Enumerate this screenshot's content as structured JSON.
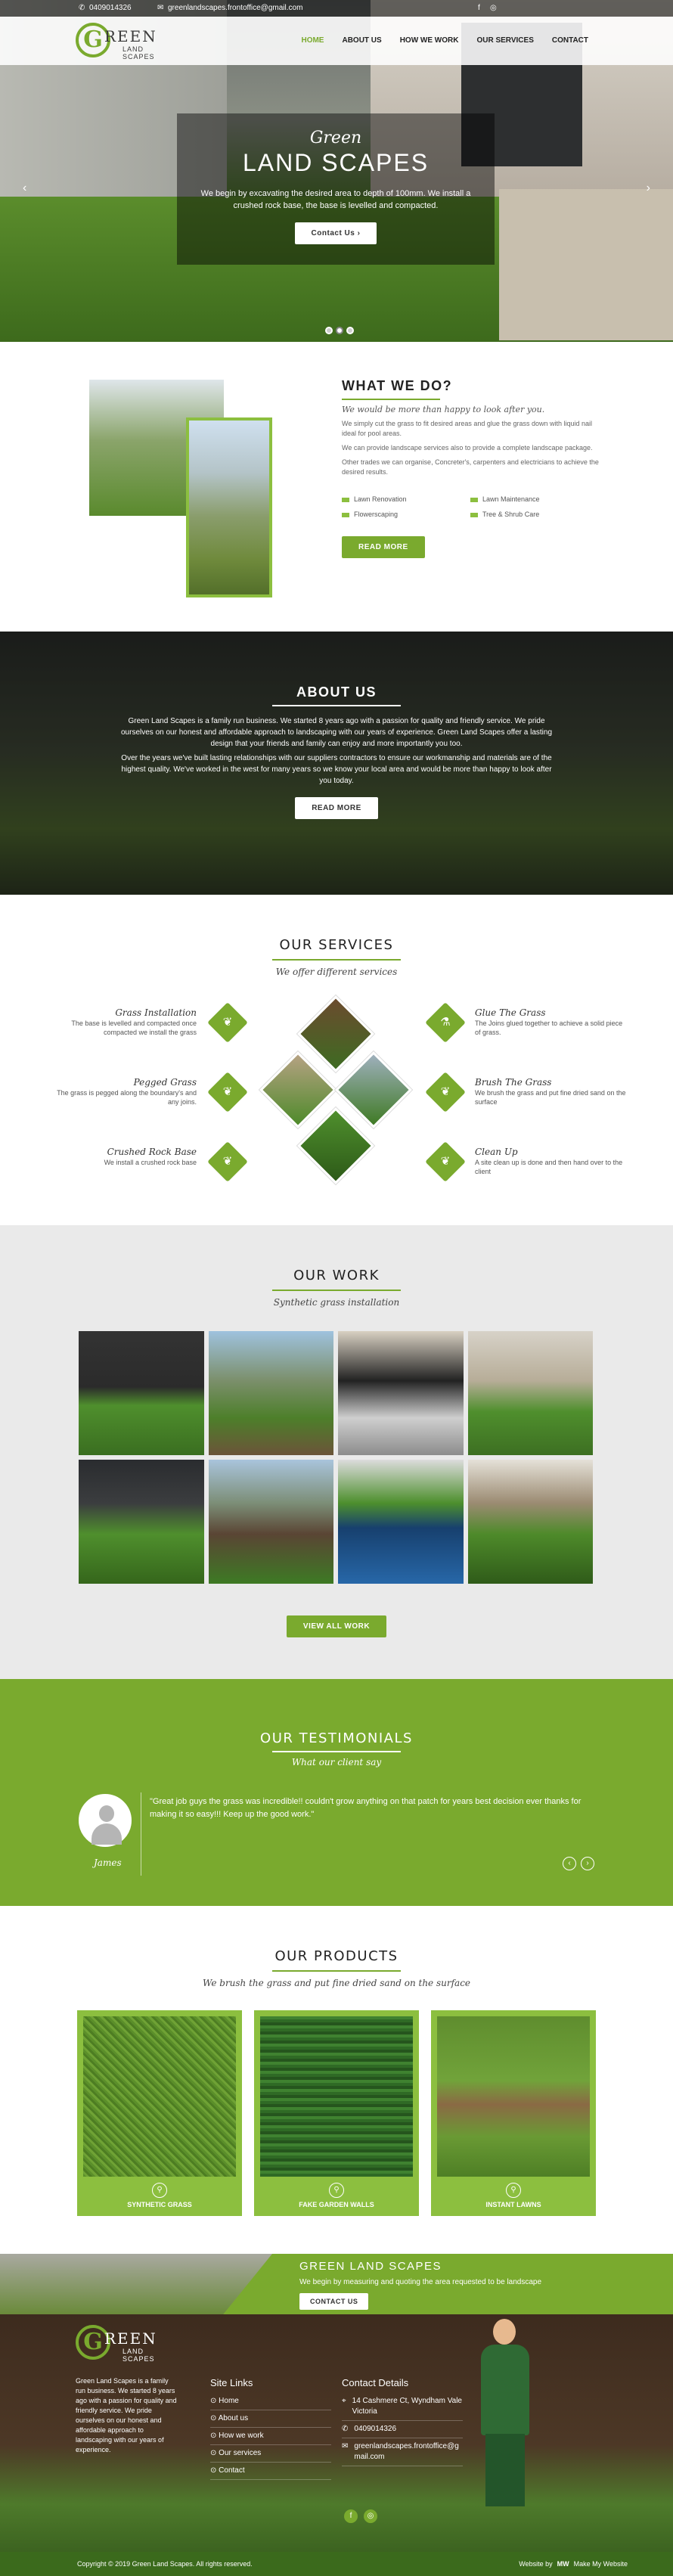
{
  "topbar": {
    "phone": "0409014326",
    "email": "greenlandscapes.frontoffice@gmail.com",
    "social": [
      "f",
      "◎"
    ]
  },
  "logo": {
    "letter": "G",
    "line1": "REEN",
    "line2": "LAND SCAPES"
  },
  "nav": {
    "items": [
      "HOME",
      "ABOUT US",
      "HOW WE WORK",
      "OUR SERVICES",
      "CONTACT"
    ],
    "active": 0
  },
  "hero": {
    "script": "Green",
    "title": "LAND SCAPES",
    "text": "We begin by excavating the desired area to depth of 100mm. We install a crushed rock base, the base is levelled and compacted.",
    "button": "Contact Us",
    "prev": "‹",
    "next": "›"
  },
  "what_we_do": {
    "title": "WHAT WE DO?",
    "tagline": "We would be more than happy to look after you.",
    "p1": "We simply cut the grass to fit desired areas and glue the grass down with liquid nail ideal for pool areas.",
    "p2": "We can provide landscape services also to provide a complete landscape package.",
    "p3": "Other trades we can organise, Concreter's, carpenters and electricians to achieve the desired results.",
    "list": [
      "Lawn Renovation",
      "Lawn Maintenance",
      "Flowerscaping",
      "Tree & Shrub Care"
    ],
    "button": "READ MORE"
  },
  "about": {
    "title": "ABOUT US",
    "p1": "Green Land Scapes is a family run business. We started 8 years ago with a passion for quality and friendly service. We pride ourselves on our honest and affordable approach to landscaping with our years of experience. Green Land Scapes offer a lasting design that your friends and family can enjoy and more importantly you too.",
    "p2": "Over the years we've built lasting relationships with our suppliers contractors to ensure our workmanship and materials are of the highest quality. We've worked in the west for many years so we know your local area and would be more than happy to look after you today.",
    "button": "READ MORE"
  },
  "services": {
    "title": "OUR SERVICES",
    "subtitle": "We offer different services",
    "items": [
      {
        "title": "Grass Installation",
        "text": "The base is levelled and compacted once compacted we install the grass",
        "icon": "leaf-icon"
      },
      {
        "title": "Pegged Grass",
        "text": "The grass is pegged along the boundary's and any joins.",
        "icon": "leaf-icon"
      },
      {
        "title": "Crushed Rock Base",
        "text": "We install a crushed rock base",
        "icon": "leaf-icon"
      },
      {
        "title": "Glue The Grass",
        "text": "The Joins glued together to achieve a solid piece of grass.",
        "icon": "glue-icon"
      },
      {
        "title": "Brush The Grass",
        "text": "We brush the grass and put fine dried sand on the surface",
        "icon": "leaf-icon"
      },
      {
        "title": "Clean Up",
        "text": "A site clean up is done and then hand over to the client",
        "icon": "leaf-icon"
      }
    ]
  },
  "work": {
    "title": "OUR WORK",
    "subtitle": "Synthetic grass installation",
    "button": "VIEW ALL WORK"
  },
  "testimonials": {
    "title": "OUR TESTIMONIALS",
    "subtitle": "What our client say",
    "quote": "\"Great job guys the grass was incredible!! couldn't grow anything on that patch for years best decision ever thanks for making it so easy!!! Keep up the good work.\"",
    "name": "James",
    "prev": "‹",
    "next": "›"
  },
  "products": {
    "title": "OUR PRODUCTS",
    "subtitle": "We brush the grass and put fine dried sand on the surface",
    "items": [
      "SYNTHETIC GRASS",
      "FAKE GARDEN WALLS",
      "INSTANT LAWNS"
    ]
  },
  "cta": {
    "title": "GREEN LAND SCAPES",
    "text": "We begin by measuring and quoting the area requested to be landscape",
    "button": "CONTACT US"
  },
  "footer": {
    "about": "Green Land Scapes is a family run business. We started 8 years ago with a passion for quality and friendly service. We pride ourselves on our honest and affordable approach to landscaping with our years of experience.",
    "links_title": "Site Links",
    "links": [
      "Home",
      "About us",
      "How we work",
      "Our services",
      "Contact"
    ],
    "contact_title": "Contact Details",
    "address": "14 Cashmere Ct, Wyndham Vale Victoria",
    "phone": "0409014326",
    "email": "greenlandscapes.frontoffice@gmail.com",
    "copyright": "Copyright © 2019 Green Land Scapes. All rights reserved.",
    "credit": "Website by",
    "credit2": "Make My Website"
  },
  "colors": {
    "accent": "#7aaa2e",
    "light_accent": "#8cbf3f"
  }
}
